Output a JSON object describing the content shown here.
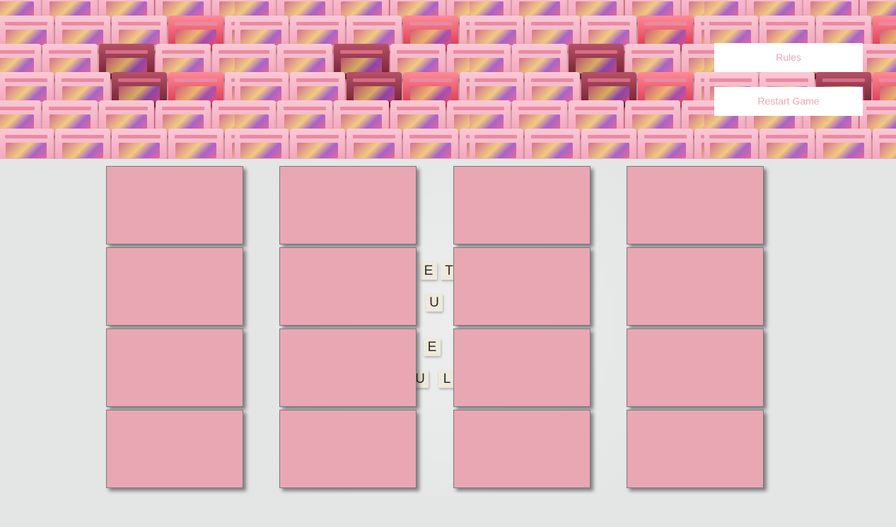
{
  "header": {
    "rules_label": "Rules",
    "restart_label": "Restart Game"
  },
  "board": {
    "card_color": "#e8a7b3",
    "card_count": 16,
    "rows": 4,
    "columns": 4,
    "cards_face_down": true
  },
  "backdrop_letters": [
    "E",
    "T",
    "U",
    "E",
    "U",
    "L"
  ],
  "colors": {
    "banner_accent": "#f4a9c0",
    "button_text": "#f4a3b6",
    "page_background": "#e4e6e6"
  }
}
